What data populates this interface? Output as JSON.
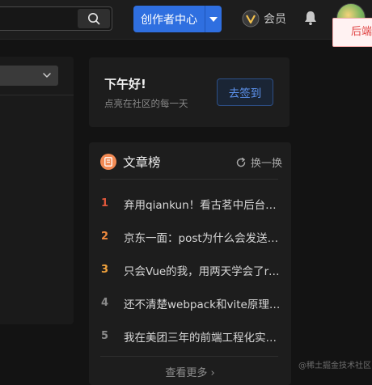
{
  "header": {
    "create_label": "创作者中心",
    "vip_label": "会员",
    "popup_text": "后端"
  },
  "signin": {
    "greeting": "下午好!",
    "subtitle": "点亮在社区的每一天",
    "button": "去签到"
  },
  "ranking": {
    "title": "文章榜",
    "refresh_label": "换一换",
    "more_label": "查看更多 ›",
    "items": [
      {
        "num": "1",
        "color": "#e0573b",
        "text": "弃用qiankun！看古茗中后台架构如何破局"
      },
      {
        "num": "2",
        "color": "#f08a3e",
        "text": "京东一面：post为什么会发送两次请求？"
      },
      {
        "num": "3",
        "color": "#f2a33d",
        "text": "只会Vue的我，用两天学会了react"
      },
      {
        "num": "4",
        "color": "#8a8a8a",
        "text": "还不清楚webpack和vite原理的区别？"
      },
      {
        "num": "5",
        "color": "#8a8a8a",
        "text": "我在美团三年的前端工程化实践回顾"
      }
    ]
  },
  "watermark": "@稀土掘金技术社区",
  "colors": {
    "accent": "#2f6fe0",
    "background": "#131313",
    "card": "#1d1d1d"
  }
}
